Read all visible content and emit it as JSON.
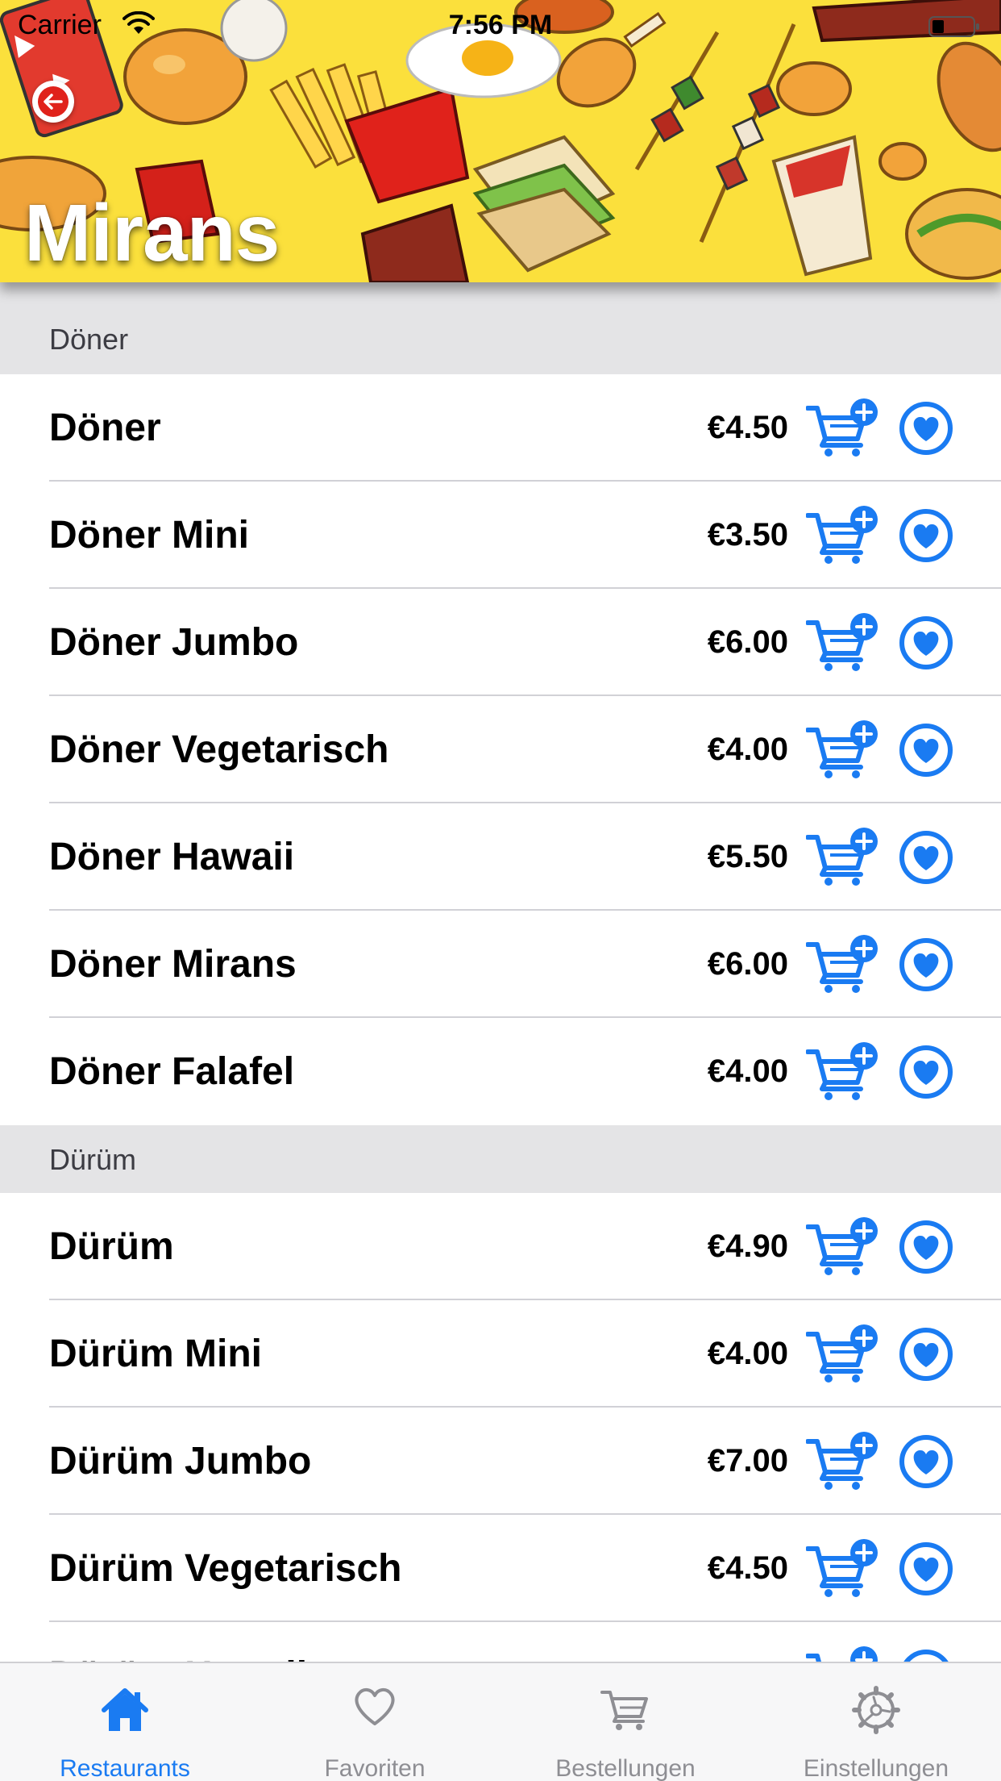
{
  "status_bar": {
    "carrier": "Carrier",
    "time": "7:56 PM"
  },
  "restaurant": {
    "name": "Mirans"
  },
  "colors": {
    "accent": "#1a7bf2",
    "header_bg": "#fbe03c",
    "section_bg": "#e4e4e6"
  },
  "sections": [
    {
      "title": "Döner",
      "items": [
        {
          "name": "Döner",
          "price": "€4.50"
        },
        {
          "name": "Döner Mini",
          "price": "€3.50"
        },
        {
          "name": "Döner Jumbo",
          "price": "€6.00"
        },
        {
          "name": "Döner Vegetarisch",
          "price": "€4.00"
        },
        {
          "name": "Döner Hawaii",
          "price": "€5.50"
        },
        {
          "name": "Döner Mirans",
          "price": "€6.00"
        },
        {
          "name": "Döner Falafel",
          "price": "€4.00"
        }
      ]
    },
    {
      "title": "Dürüm",
      "items": [
        {
          "name": "Dürüm",
          "price": "€4.90"
        },
        {
          "name": "Dürüm Mini",
          "price": "€4.00"
        },
        {
          "name": "Dürüm Jumbo",
          "price": "€7.00"
        },
        {
          "name": "Dürüm Vegetarisch",
          "price": "€4.50"
        },
        {
          "name": "Dürüm Hawaii",
          "price": ""
        }
      ]
    }
  ],
  "icons": {
    "back": "arrow-left-icon",
    "cart_add": "cart-plus-icon",
    "favorite": "heart-circle-icon"
  },
  "tab_bar": {
    "tabs": [
      {
        "label": "Restaurants",
        "icon": "house-icon",
        "active": true
      },
      {
        "label": "Favoriten",
        "icon": "heart-icon",
        "active": false
      },
      {
        "label": "Bestellungen",
        "icon": "cart-icon",
        "active": false
      },
      {
        "label": "Einstellungen",
        "icon": "gear-icon",
        "active": false
      }
    ]
  }
}
